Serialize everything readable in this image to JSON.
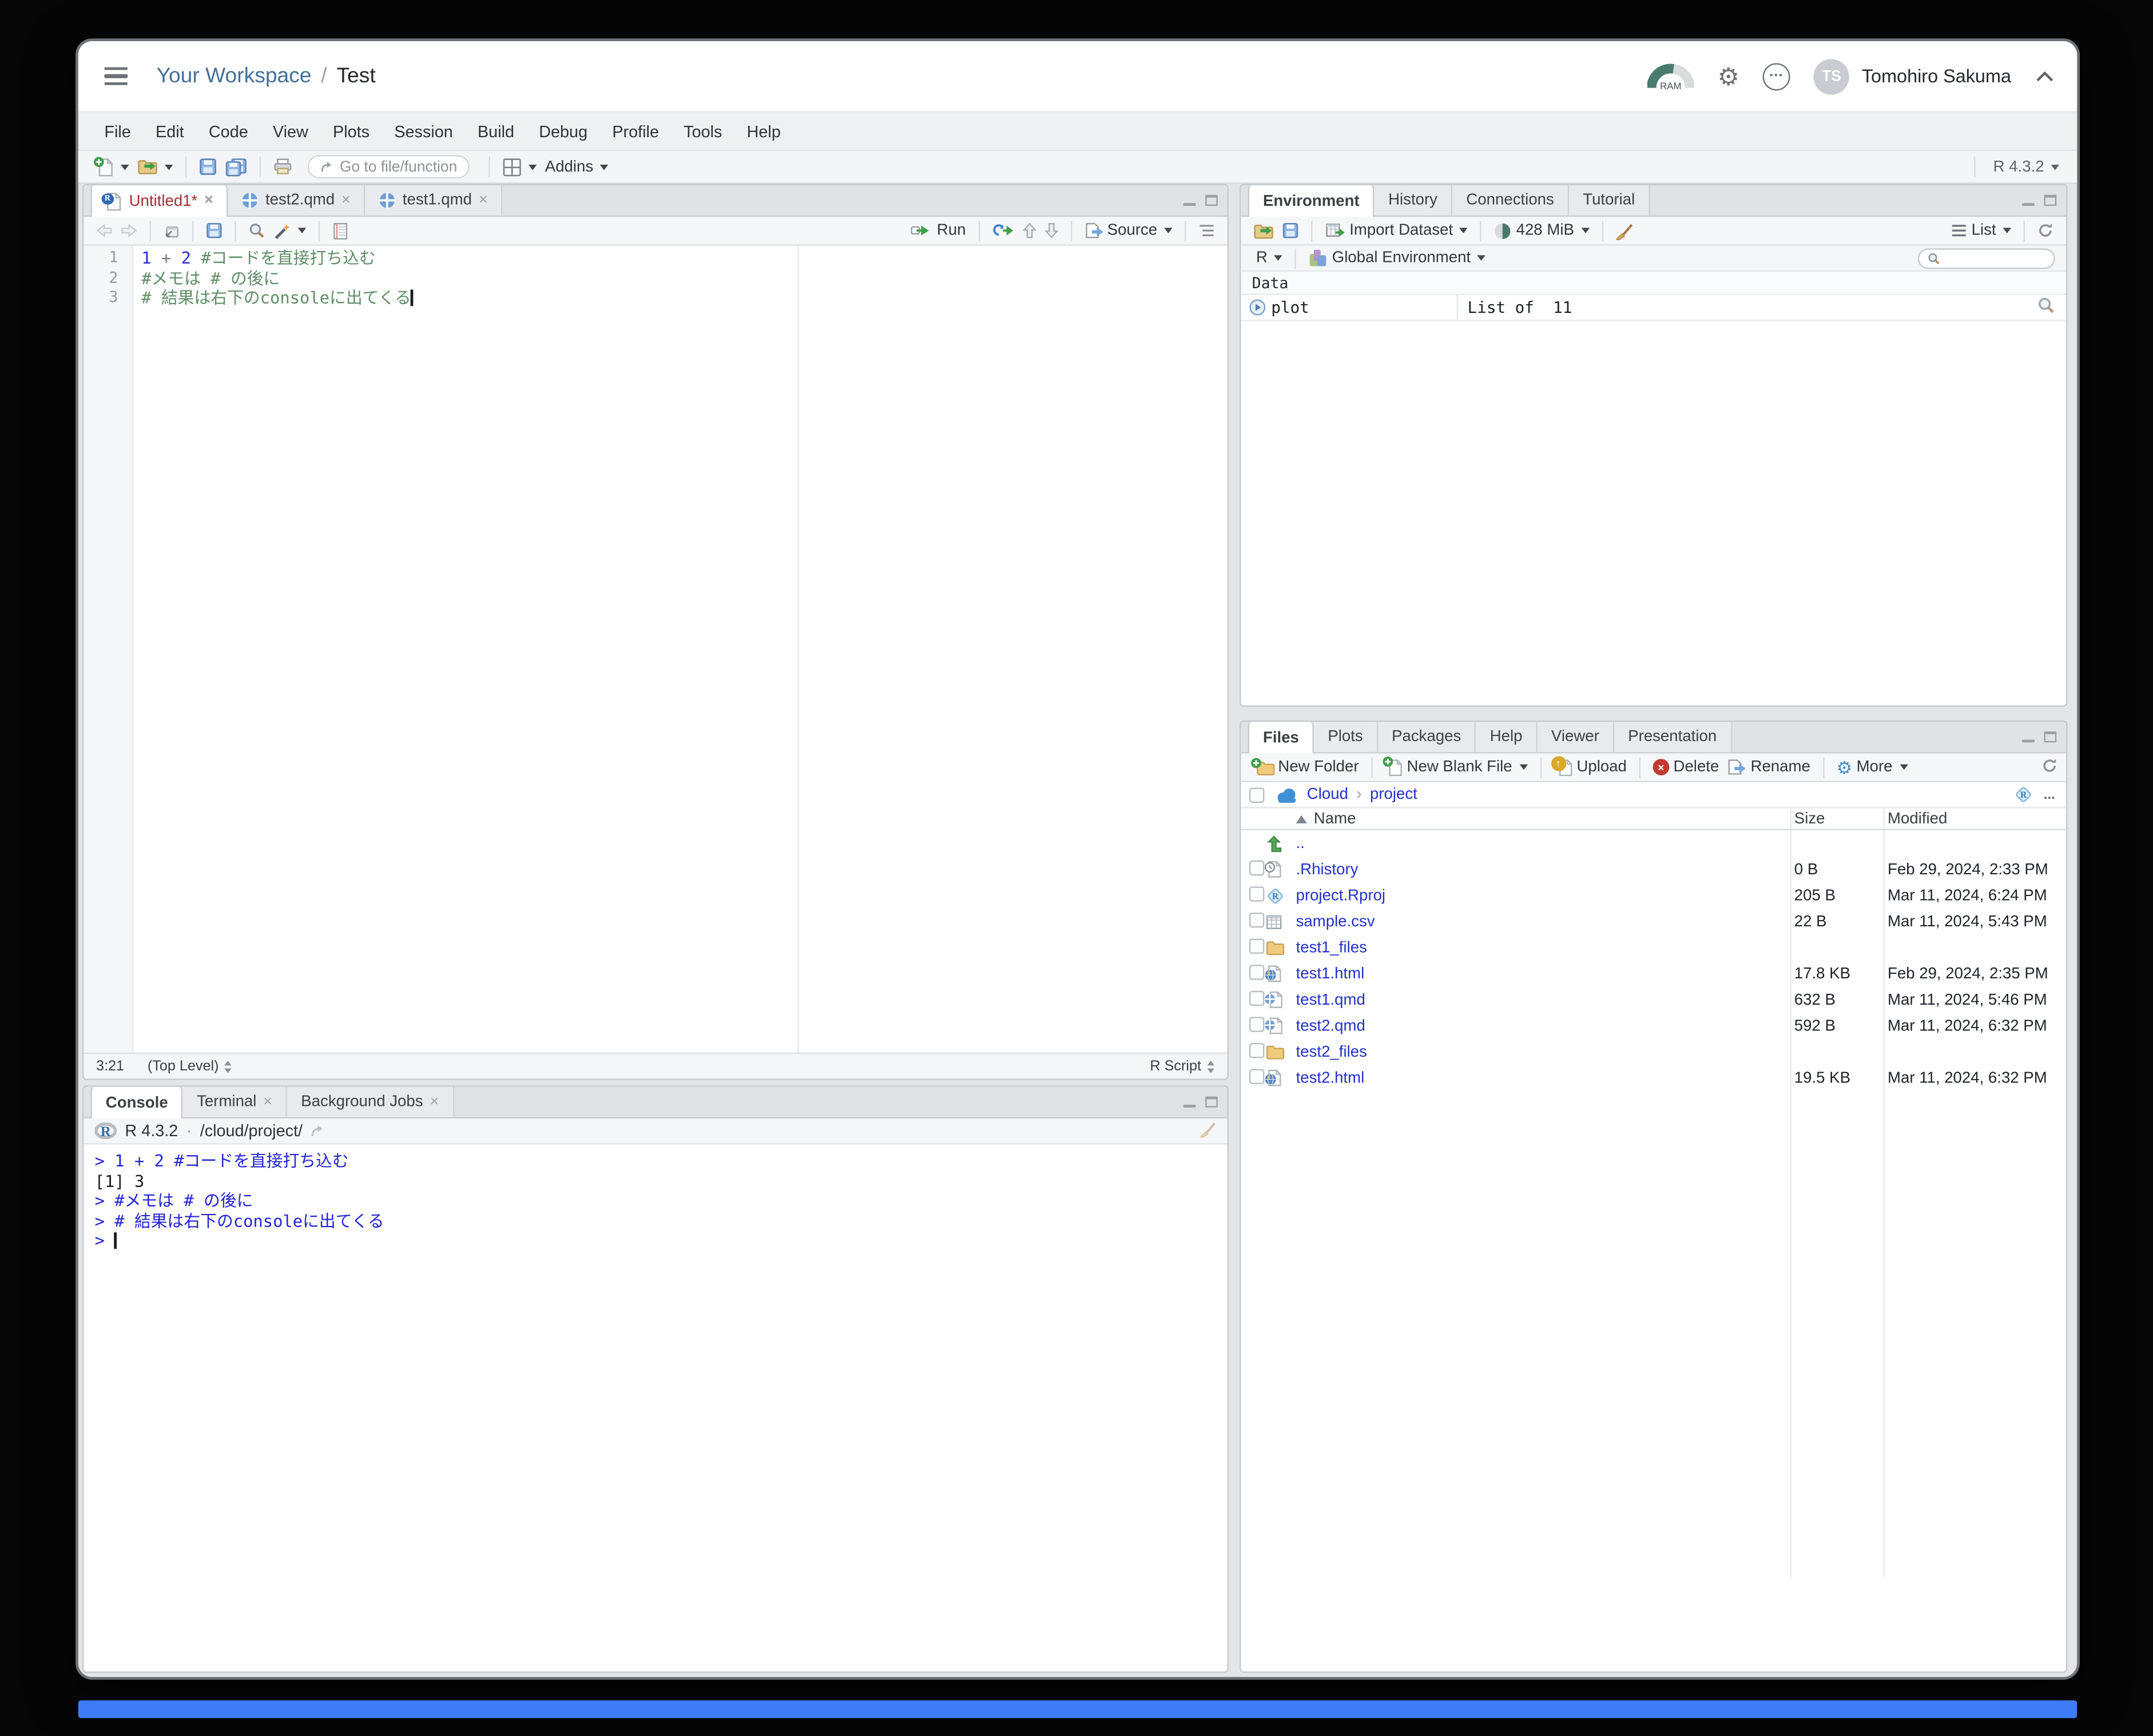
{
  "header": {
    "breadcrumb": {
      "workspace": "Your Workspace",
      "separator": "/",
      "project": "Test"
    },
    "ram_gauge_label": "RAM",
    "user_initials": "TS",
    "user_name": "Tomohiro Sakuma"
  },
  "menu_items": [
    "File",
    "Edit",
    "Code",
    "View",
    "Plots",
    "Session",
    "Build",
    "Debug",
    "Profile",
    "Tools",
    "Help"
  ],
  "main_toolbar": {
    "goto_placeholder": "Go to file/function",
    "addins": "Addins",
    "r_version": "R 4.3.2"
  },
  "editor": {
    "tabs": [
      {
        "label": "Untitled1*"
      },
      {
        "label": "test2.qmd"
      },
      {
        "label": "test1.qmd"
      }
    ],
    "toolbar": {
      "run": "Run",
      "source": "Source"
    },
    "code_lines": [
      {
        "num": "1",
        "n1": "1",
        "op": " + ",
        "n2": "2",
        "comment": " #コードを直接打ち込む"
      },
      {
        "num": "2",
        "comment": "#メモは # の後に"
      },
      {
        "num": "3",
        "comment": "# 結果は右下のconsoleに出てくる"
      }
    ],
    "status": {
      "cursor": "3:21",
      "scope": "(Top Level)",
      "file_type": "R Script"
    }
  },
  "console": {
    "tabs": [
      "Console",
      "Terminal",
      "Background Jobs"
    ],
    "info": {
      "r_version": "R 4.3.2",
      "separator": "·",
      "working_dir": "/cloud/project/"
    },
    "lines": [
      {
        "text": "> 1 + 2 #コードを直接打ち込む",
        "kind": "input"
      },
      {
        "text": "[1] 3",
        "kind": "output"
      },
      {
        "text": "> #メモは # の後に",
        "kind": "input"
      },
      {
        "text": "> # 結果は右下のconsoleに出てくる",
        "kind": "input"
      },
      {
        "text": ">",
        "kind": "prompt"
      }
    ]
  },
  "environment": {
    "tabs": [
      "Environment",
      "History",
      "Connections",
      "Tutorial"
    ],
    "toolbar": {
      "import_dataset": "Import Dataset",
      "memory": "428 MiB",
      "list_view": "List"
    },
    "scope": {
      "language": "R",
      "environment": "Global Environment"
    },
    "section": "Data",
    "objects": [
      {
        "name": "plot",
        "value": "List of  11"
      }
    ]
  },
  "files": {
    "tabs": [
      "Files",
      "Plots",
      "Packages",
      "Help",
      "Viewer",
      "Presentation"
    ],
    "toolbar": {
      "new_folder": "New Folder",
      "new_blank_file": "New Blank File",
      "upload": "Upload",
      "delete": "Delete",
      "rename": "Rename",
      "more": "More"
    },
    "breadcrumb": {
      "root": "Cloud",
      "chevron": "›",
      "folder": "project",
      "overflow": "..."
    },
    "columns": {
      "name": "Name",
      "size": "Size",
      "modified": "Modified"
    },
    "rows": [
      {
        "icon": "up-dir-icon",
        "name": "..",
        "size": "",
        "modified": ""
      },
      {
        "icon": "rhistory-file-icon",
        "name": ".Rhistory",
        "size": "0 B",
        "modified": "Feb 29, 2024, 2:33 PM"
      },
      {
        "icon": "rproj-file-icon",
        "name": "project.Rproj",
        "size": "205 B",
        "modified": "Mar 11, 2024, 6:24 PM"
      },
      {
        "icon": "csv-file-icon",
        "name": "sample.csv",
        "size": "22 B",
        "modified": "Mar 11, 2024, 5:43 PM"
      },
      {
        "icon": "folder-icon",
        "name": "test1_files",
        "size": "",
        "modified": ""
      },
      {
        "icon": "html-file-icon",
        "name": "test1.html",
        "size": "17.8 KB",
        "modified": "Feb 29, 2024, 2:35 PM"
      },
      {
        "icon": "qmd-file-icon",
        "name": "test1.qmd",
        "size": "632 B",
        "modified": "Mar 11, 2024, 5:46 PM"
      },
      {
        "icon": "qmd-file-icon",
        "name": "test2.qmd",
        "size": "592 B",
        "modified": "Mar 11, 2024, 6:32 PM"
      },
      {
        "icon": "folder-icon",
        "name": "test2_files",
        "size": "",
        "modified": ""
      },
      {
        "icon": "html-file-icon",
        "name": "test2.html",
        "size": "19.5 KB",
        "modified": "Mar 11, 2024, 6:32 PM"
      }
    ]
  },
  "colors": {
    "accent_blue": "#3d7cf6",
    "link_blue": "#2331c8",
    "console_input_blue": "#2222d8",
    "comment_green": "#5e8d66",
    "ram_teal": "#487c6e",
    "posit_blue": "#447099"
  }
}
